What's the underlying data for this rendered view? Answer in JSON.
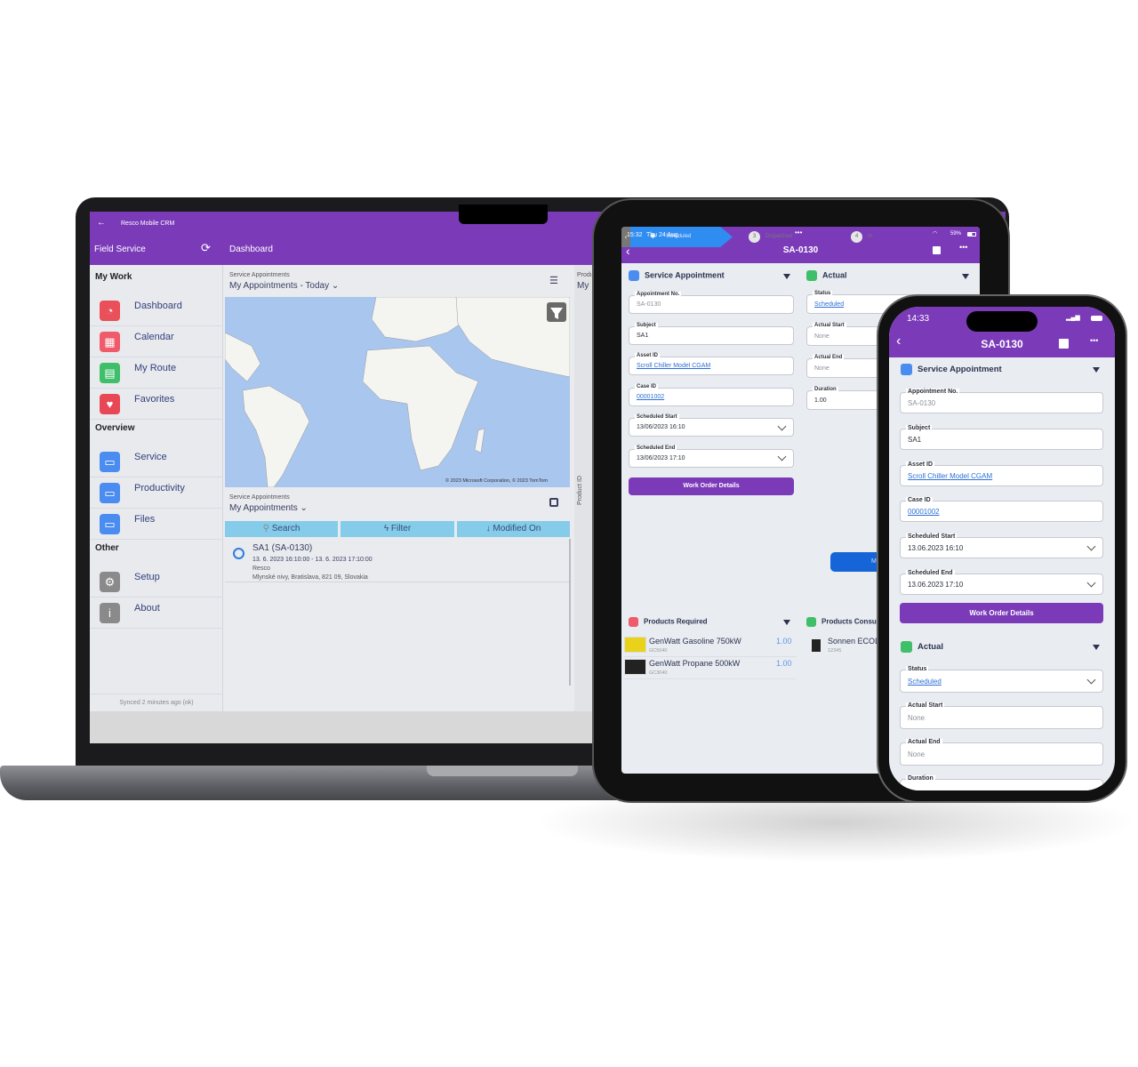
{
  "colors": {
    "brand_purple": "#7b3bb9",
    "accent_blue": "#2f8cf0",
    "link": "#2d6fd6",
    "search_bar": "#84cce9"
  },
  "laptop": {
    "title_bar": "Resco Mobile CRM",
    "app_name": "Field Service",
    "page_title": "Dashboard",
    "sidebar": {
      "sections": [
        {
          "title": "My Work",
          "items": [
            {
              "label": "Dashboard",
              "icon": "dashboard-icon",
              "color": "#e9505a"
            },
            {
              "label": "Calendar",
              "icon": "calendar-icon",
              "color": "#ef5b6b"
            },
            {
              "label": "My Route",
              "icon": "map-icon",
              "color": "#3fbf6a"
            },
            {
              "label": "Favorites",
              "icon": "heart-icon",
              "color": "#e84855"
            }
          ]
        },
        {
          "title": "Overview",
          "items": [
            {
              "label": "Service",
              "icon": "folder-icon",
              "color": "#4a8cf0"
            },
            {
              "label": "Productivity",
              "icon": "folder-icon",
              "color": "#4a8cf0"
            },
            {
              "label": "Files",
              "icon": "folder-icon",
              "color": "#4a8cf0"
            }
          ]
        },
        {
          "title": "Other",
          "items": [
            {
              "label": "Setup",
              "icon": "gear-icon",
              "color": "#8a8a8a"
            },
            {
              "label": "About",
              "icon": "info-icon",
              "color": "#8a8a8a"
            }
          ]
        }
      ],
      "sync_status": "Synced 2 minutes ago (ok)"
    },
    "map_view": {
      "entity": "Service Appointments",
      "view": "My Appointments - Today",
      "attribution": "© 2023 Microsoft Corporation, © 2023 TomTom"
    },
    "list_view": {
      "entity": "Service Appointments",
      "view": "My Appointments",
      "search": "Search",
      "filter": "Filter",
      "sort": "Modified On",
      "items": [
        {
          "title": "SA1 (SA-0130)",
          "time": "13. 6. 2023 16:10:00 - 13. 6. 2023 17:10:00",
          "account": "Resco",
          "address": "Mlynské nivy, Bratislava, 821 09, Slovakia"
        }
      ]
    },
    "side_panel": {
      "entity": "Produ",
      "view": "My",
      "column": "Product ID"
    }
  },
  "tablet": {
    "status_bar": {
      "time": "15:32",
      "date": "Thu 24 Aug",
      "battery": "59%"
    },
    "title": "SA-0130",
    "service_appointment": {
      "title": "Service Appointment",
      "fields": [
        {
          "label": "Appointment No.",
          "value": "SA-0130",
          "type": "readonly"
        },
        {
          "label": "Subject",
          "value": "SA1",
          "type": "text"
        },
        {
          "label": "Asset ID",
          "value": "Scroll Chiller Model CGAM",
          "type": "link"
        },
        {
          "label": "Case ID",
          "value": "00001002",
          "type": "link"
        },
        {
          "label": "Scheduled Start",
          "value": "13/06/2023 16:10",
          "type": "dropdown"
        },
        {
          "label": "Scheduled End",
          "value": "13/06/2023 17:10",
          "type": "dropdown"
        }
      ],
      "button": "Work Order Details"
    },
    "actual": {
      "title": "Actual",
      "fields": [
        {
          "label": "Status",
          "value": "Scheduled",
          "type": "link"
        },
        {
          "label": "Actual Start",
          "value": "None",
          "type": "readonly"
        },
        {
          "label": "Actual End",
          "value": "None",
          "type": "readonly"
        },
        {
          "label": "Duration",
          "value": "1.00",
          "type": "text"
        }
      ]
    },
    "process": {
      "stages": [
        {
          "num": "",
          "label": "Scheduled",
          "active": true
        },
        {
          "num": "3",
          "label": "Dispatched"
        },
        {
          "num": "4",
          "label": "In"
        }
      ],
      "button": "M"
    },
    "products_required": {
      "title": "Products Required",
      "items": [
        {
          "name": "GenWatt Gasoline 750kW",
          "code": "GC5040",
          "qty": "1.00"
        },
        {
          "name": "GenWatt Propane 500kW",
          "code": "GC3040",
          "qty": "1.00"
        }
      ]
    },
    "products_consumed": {
      "title": "Products Consu",
      "items": [
        {
          "name": "Sonnen ECOL",
          "code": "12345"
        }
      ]
    }
  },
  "phone": {
    "status_bar": {
      "time": "14:33"
    },
    "title": "SA-0130",
    "service_appointment": {
      "title": "Service Appointment",
      "fields": [
        {
          "label": "Appointment No.",
          "value": "SA-0130",
          "type": "readonly"
        },
        {
          "label": "Subject",
          "value": "SA1",
          "type": "text"
        },
        {
          "label": "Asset ID",
          "value": "Scroll Chiller Model CGAM",
          "type": "link"
        },
        {
          "label": "Case ID",
          "value": "00001002",
          "type": "link"
        },
        {
          "label": "Scheduled Start",
          "value": "13.06.2023 16:10",
          "type": "dropdown"
        },
        {
          "label": "Scheduled End",
          "value": "13.06.2023 17:10",
          "type": "dropdown"
        }
      ],
      "button": "Work Order Details"
    },
    "actual": {
      "title": "Actual",
      "fields": [
        {
          "label": "Status",
          "value": "Scheduled",
          "type": "link-dropdown"
        },
        {
          "label": "Actual Start",
          "value": "None",
          "type": "readonly"
        },
        {
          "label": "Actual End",
          "value": "None",
          "type": "readonly"
        },
        {
          "label": "Duration",
          "value": "",
          "type": "text"
        }
      ]
    }
  }
}
